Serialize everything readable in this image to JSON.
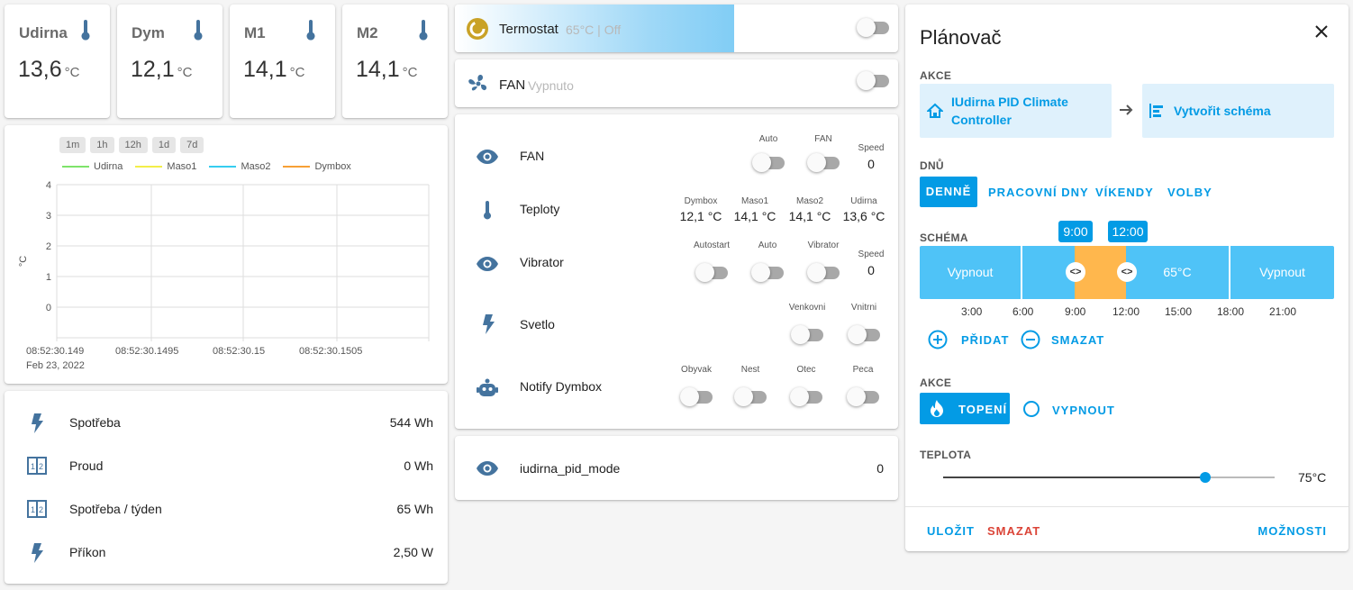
{
  "temps": [
    {
      "name": "Udirna",
      "value": "13,6",
      "unit": "°C"
    },
    {
      "name": "Dym",
      "value": "12,1",
      "unit": "°C"
    },
    {
      "name": "M1",
      "value": "14,1",
      "unit": "°C"
    },
    {
      "name": "M2",
      "value": "14,1",
      "unit": "°C"
    }
  ],
  "graph": {
    "ranges": [
      "1m",
      "1h",
      "12h",
      "1d",
      "7d"
    ],
    "legend": [
      {
        "name": "Udirna",
        "color": "#7ee36a"
      },
      {
        "name": "Maso1",
        "color": "#f3ee49"
      },
      {
        "name": "Maso2",
        "color": "#36cdf0"
      },
      {
        "name": "Dymbox",
        "color": "#f7a035"
      }
    ],
    "ylabel": "°C",
    "yticks": [
      "4",
      "3",
      "2",
      "1",
      "0"
    ],
    "xticks": [
      "08:52:30.149",
      "08:52:30.1495",
      "08:52:30.15",
      "08:52:30.1505"
    ],
    "xdate": "Feb 23, 2022"
  },
  "energy": [
    {
      "label": "Spotřeba",
      "value": "544 Wh",
      "icon": "flash-icon"
    },
    {
      "label": "Proud",
      "value": "0 Wh",
      "icon": "meter-icon"
    },
    {
      "label": "Spotřeba / týden",
      "value": "65 Wh",
      "icon": "meter-icon"
    },
    {
      "label": "Příkon",
      "value": "2,50 W",
      "icon": "flash-icon"
    }
  ],
  "termostat": {
    "name": "Termostat",
    "state": "65°C | Off"
  },
  "fan": {
    "name": "FAN",
    "state": "Vypnuto"
  },
  "controls": {
    "fan": {
      "label": "FAN",
      "auto": "Auto",
      "fan": "FAN",
      "speed_label": "Speed",
      "speed": "0"
    },
    "teploty": {
      "label": "Teploty",
      "cols": [
        {
          "h": "Dymbox",
          "v": "12,1 °C"
        },
        {
          "h": "Maso1",
          "v": "14,1 °C"
        },
        {
          "h": "Maso2",
          "v": "14,1 °C"
        },
        {
          "h": "Udirna",
          "v": "13,6 °C"
        }
      ]
    },
    "vibrator": {
      "label": "Vibrator",
      "autostart": "Autostart",
      "auto": "Auto",
      "vibrator": "Vibrator",
      "speed_label": "Speed",
      "speed": "0"
    },
    "svetlo": {
      "label": "Svetlo",
      "venkovni": "Venkovni",
      "vnitrni": "Vnitrni"
    },
    "notify": {
      "label": "Notify Dymbox",
      "obyvak": "Obyvak",
      "nest": "Nest",
      "otec": "Otec",
      "peca": "Peca"
    }
  },
  "pid": {
    "label": "iudirna_pid_mode",
    "value": "0"
  },
  "planner": {
    "title": "Plánovač",
    "akce_label": "AKCE",
    "entity": "IUdirna PID Climate Controller",
    "create": "Vytvořit schéma",
    "dnu_label": "DNŮ",
    "days": [
      "DENNĚ",
      "PRACOVNÍ DNY",
      "VÍKENDY",
      "VOLBY"
    ],
    "schema_label": "SCHÉMA",
    "marker_start": "9:00",
    "marker_end": "12:00",
    "segments": [
      "Vypnout",
      "65°C",
      "Vypnout"
    ],
    "times": [
      "3:00",
      "6:00",
      "9:00",
      "12:00",
      "15:00",
      "18:00",
      "21:00"
    ],
    "add": "PŘIDAT",
    "remove": "SMAZAT",
    "akce2_label": "AKCE",
    "heat": "TOPENÍ",
    "off": "VYPNOUT",
    "teplota_label": "TEPLOTA",
    "temp_value": "75°C",
    "temp_fraction": 0.79,
    "save": "ULOŽIT",
    "delete": "SMAZAT",
    "options": "MOŽNOSTI",
    "colors": {
      "accent": "#039be5",
      "segment": "#4fc3f7",
      "selected": "#ffb74d",
      "danger": "#db4437"
    }
  }
}
